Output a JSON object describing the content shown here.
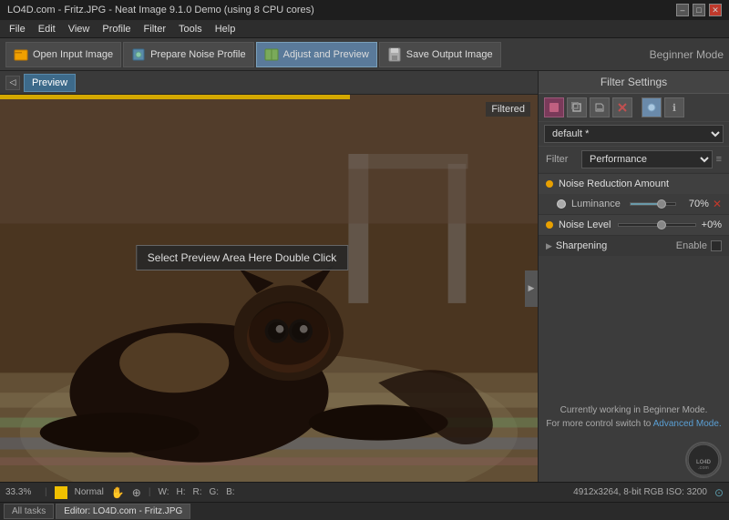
{
  "titlebar": {
    "title": "LO4D.com - Fritz.JPG - Neat Image 9.1.0 Demo (using 8 CPU cores)",
    "min_label": "–",
    "max_label": "□",
    "close_label": "✕"
  },
  "menubar": {
    "items": [
      "File",
      "Edit",
      "View",
      "Profile",
      "Filter",
      "Tools",
      "Help"
    ]
  },
  "toolbar": {
    "open_input": "Open Input Image",
    "prepare_noise": "Prepare Noise Profile",
    "adjust_preview": "Adjust and Preview",
    "save_output": "Save Output Image",
    "beginner_mode": "Beginner Mode"
  },
  "subtoolbar": {
    "preview_label": "Preview"
  },
  "image": {
    "filtered_badge": "Filtered",
    "tooltip_text": "Select Preview Area Here   Double Click"
  },
  "filter_settings": {
    "title": "Filter Settings",
    "preset_value": "default *",
    "filter_label": "Filter",
    "filter_value": "Performance",
    "noise_reduction_label": "Noise Reduction Amount",
    "luminance_label": "Luminance",
    "luminance_value": "70%",
    "luminance_percent": 70,
    "noise_level_label": "Noise Level",
    "noise_level_value": "+0%",
    "sharpening_label": "Sharpening",
    "enable_label": "Enable"
  },
  "statusbar": {
    "zoom": "33.3%",
    "mode": "Normal",
    "width_label": "W:",
    "height_label": "H:",
    "r_label": "R:",
    "g_label": "G:",
    "b_label": "B:",
    "info": "4912x3264, 8-bit RGB  ISO: 3200"
  },
  "tabbar": {
    "all_tasks_label": "All tasks",
    "editor_tab_label": "Editor: LO4D.com - Fritz.JPG"
  },
  "footer": {
    "line1": "Currently working in Beginner Mode.",
    "line2": "For more control switch to",
    "link": "Advanced Mode."
  },
  "lo4d": {
    "text": "LO4D.com"
  }
}
